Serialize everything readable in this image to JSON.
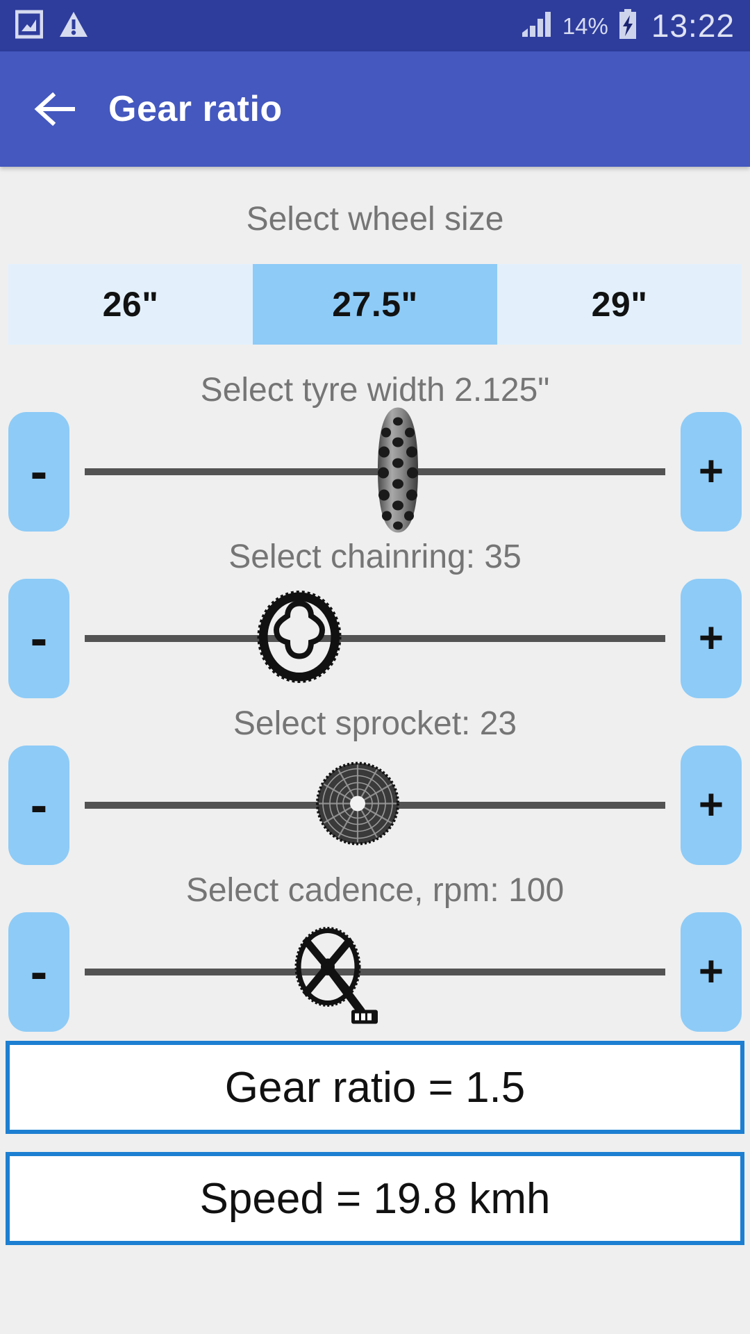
{
  "status_bar": {
    "icons_left": [
      "screenshot-image-icon",
      "warning-triangle-icon"
    ],
    "signal_icon": "signal-bars-icon",
    "battery_percent": "14%",
    "battery_icon": "battery-charging-icon",
    "clock": "13:22",
    "background_color": "#2e3d9c"
  },
  "app_bar": {
    "back_icon": "back-arrow-icon",
    "title": "Gear ratio",
    "background_color": "#4458bf"
  },
  "wheel_size": {
    "label": "Select wheel size",
    "options": [
      {
        "label": "26\"",
        "selected": false
      },
      {
        "label": "27.5\"",
        "selected": true
      },
      {
        "label": "29\"",
        "selected": false
      }
    ],
    "selected_color": "#8ecbf7",
    "unselected_color": "#e3f0fc"
  },
  "sliders": [
    {
      "key": "tyre_width",
      "label": "Select tyre width 2.125\"",
      "value": "2.125\"",
      "thumb_icon": "tyre-tread-icon",
      "thumb_percent": 54,
      "minus_label": "-",
      "plus_label": "+"
    },
    {
      "key": "chainring",
      "label": "Select chainring: 35",
      "value": "35",
      "thumb_icon": "chainring-icon",
      "thumb_percent": 37,
      "minus_label": "-",
      "plus_label": "+"
    },
    {
      "key": "sprocket",
      "label": "Select sprocket: 23",
      "value": "23",
      "thumb_icon": "sprocket-cassette-icon",
      "thumb_percent": 47,
      "minus_label": "-",
      "plus_label": "+"
    },
    {
      "key": "cadence",
      "label": "Select cadence, rpm: 100",
      "value": "100",
      "thumb_icon": "crankset-icon",
      "thumb_percent": 43,
      "minus_label": "-",
      "plus_label": "+"
    }
  ],
  "results": [
    {
      "key": "gear_ratio",
      "text": "Gear ratio = 1.5"
    },
    {
      "key": "speed",
      "text": "Speed = 19.8 kmh"
    }
  ],
  "colors": {
    "accent_blue": "#8ecbf7",
    "result_border": "#1d7fd1",
    "page_background": "#efefef",
    "track": "#535353",
    "label_text": "#757575"
  }
}
